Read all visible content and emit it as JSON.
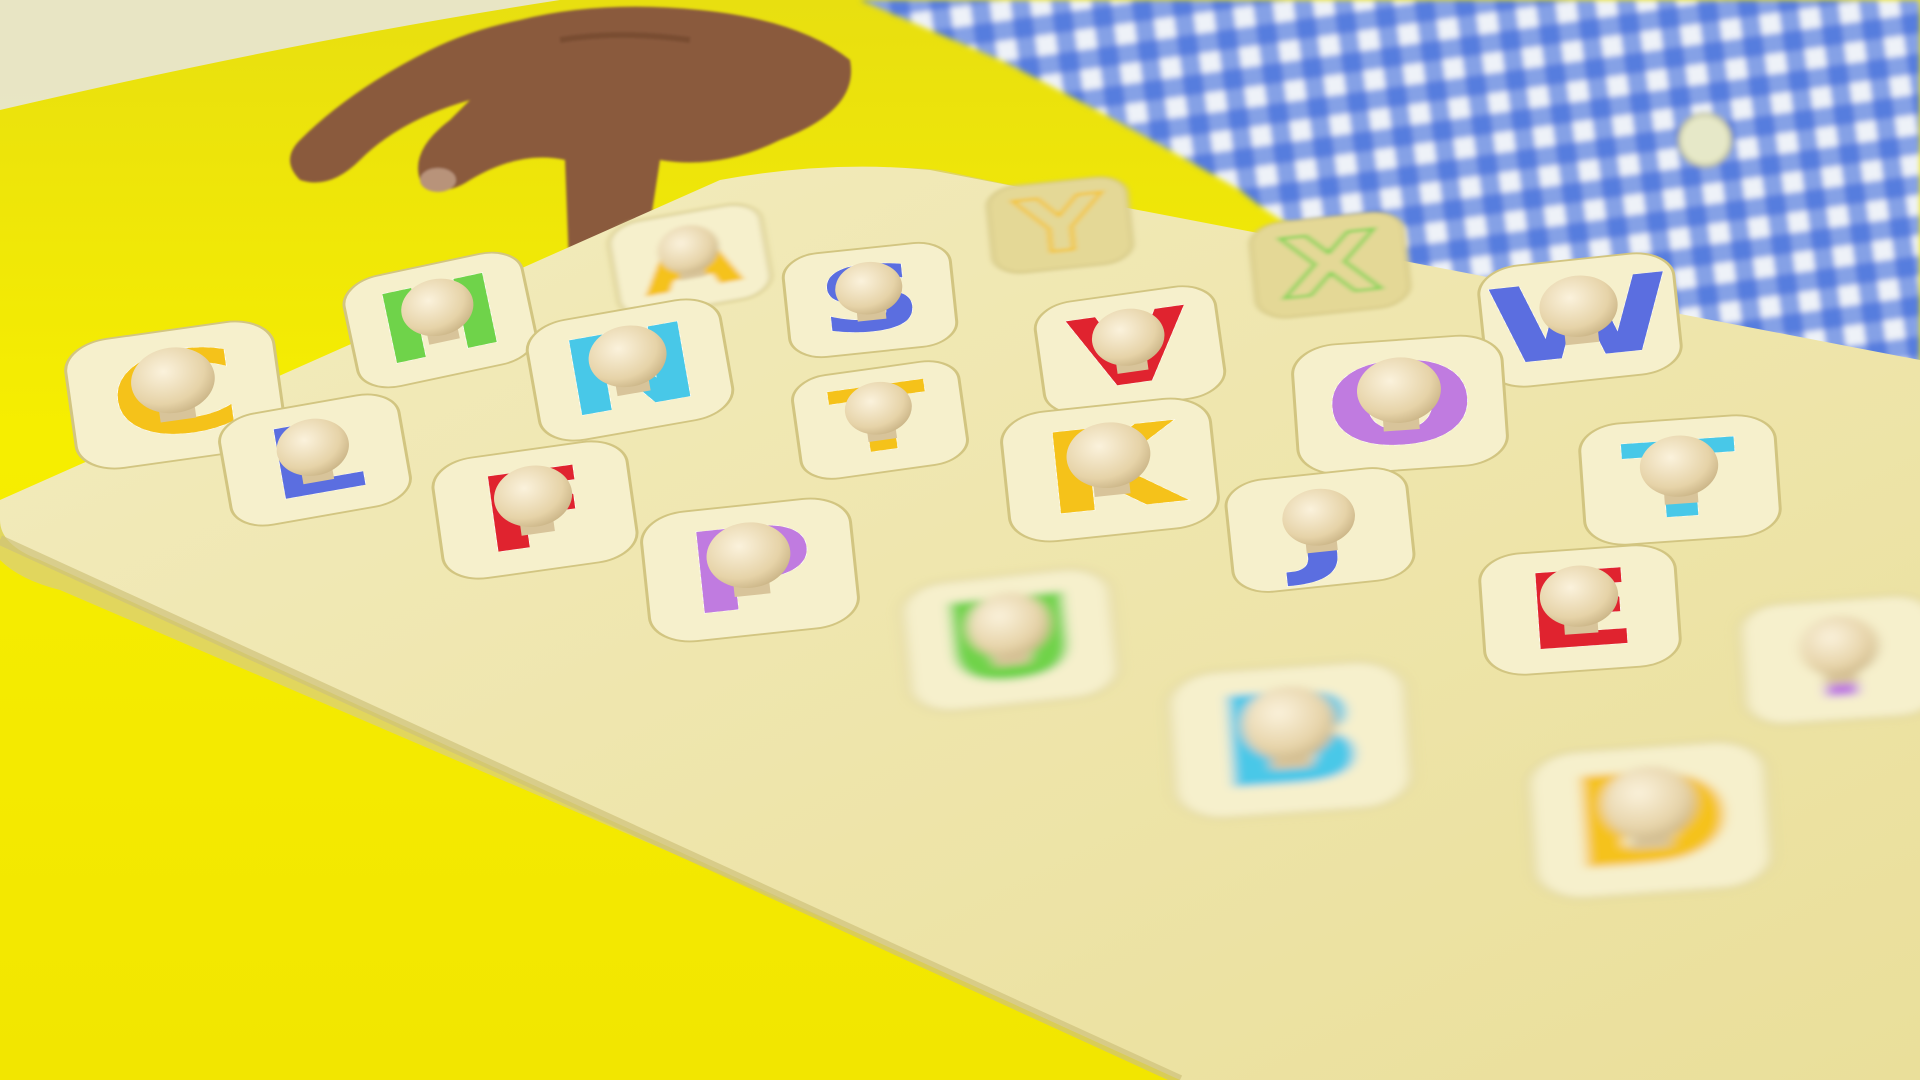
{
  "scene": {
    "subject": "child's wooden alphabet peg puzzle on a yellow table",
    "colors": {
      "table": "#f4ec00",
      "board": "#efe6a8",
      "board_edge": "#d9cf8f",
      "shirt_blue": "#2f5fd6",
      "shirt_white": "#eef2f8",
      "skin": "#8a5a3c",
      "knob": "#ead9b5"
    }
  },
  "letters": [
    {
      "char": "C",
      "color": "#f5c21a",
      "state": "placed"
    },
    {
      "char": "H",
      "color": "#6fd34a",
      "state": "placed"
    },
    {
      "char": "A",
      "color": "#f5c21a",
      "state": "placed"
    },
    {
      "char": "S",
      "color": "#5b6ee0",
      "state": "placed"
    },
    {
      "char": "V",
      "color": "#e0232f",
      "state": "placed"
    },
    {
      "char": "X",
      "color": "#6fd34a",
      "state": "empty-slot"
    },
    {
      "char": "W",
      "color": "#5b6ee0",
      "state": "placed"
    },
    {
      "char": "Y",
      "color": "#f5c21a",
      "state": "empty-slot"
    },
    {
      "char": "N",
      "color": "#48c8e8",
      "state": "placed"
    },
    {
      "char": "T",
      "color": "#f5c21a",
      "state": "placed"
    },
    {
      "char": "O",
      "color": "#c07be0",
      "state": "placed"
    },
    {
      "char": "L",
      "color": "#5b6ee0",
      "state": "placed"
    },
    {
      "char": "F",
      "color": "#e0232f",
      "state": "placed"
    },
    {
      "char": "K",
      "color": "#f5c21a",
      "state": "placed"
    },
    {
      "char": "J",
      "color": "#5b6ee0",
      "state": "placed"
    },
    {
      "char": "P",
      "color": "#c07be0",
      "state": "placed"
    },
    {
      "char": "U",
      "color": "#6fd34a",
      "state": "placed"
    },
    {
      "char": "T",
      "color": "#48c8e8",
      "state": "placed"
    },
    {
      "char": "E",
      "color": "#e0232f",
      "state": "placed"
    },
    {
      "char": "B",
      "color": "#48c8e8",
      "state": "placed"
    },
    {
      "char": "D",
      "color": "#f5c21a",
      "state": "placed"
    },
    {
      "char": "I",
      "color": "#c07be0",
      "state": "placed"
    }
  ]
}
